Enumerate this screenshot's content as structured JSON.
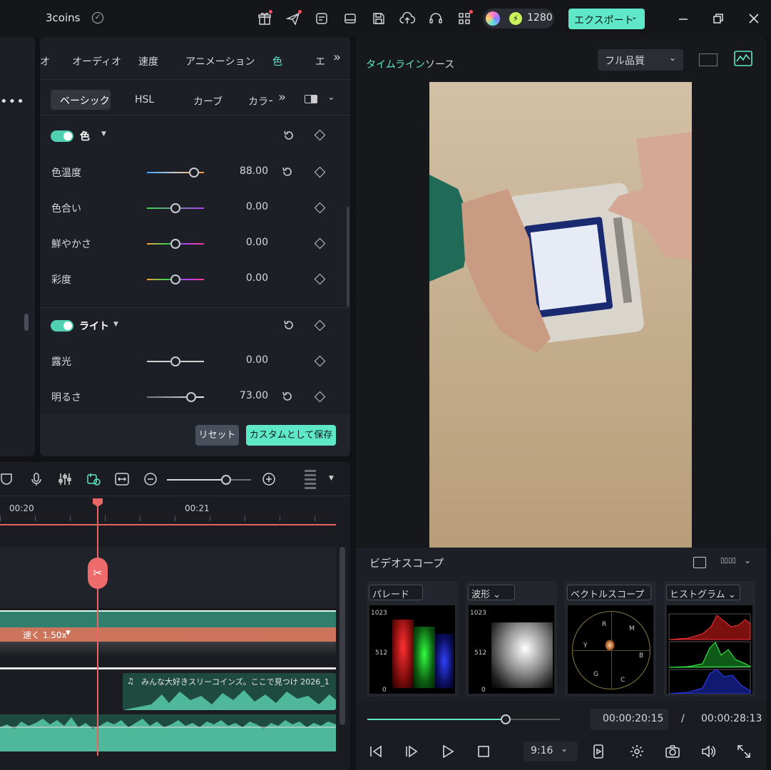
{
  "app": {
    "project_name": "3coins",
    "credits": "1280",
    "export_label": "エクスポート"
  },
  "props": {
    "tabs": [
      "オ",
      "オーディオ",
      "速度",
      "アニメーション",
      "色",
      "エ"
    ],
    "active_tab": "色",
    "subtabs": [
      "ベーシック",
      "HSL",
      "カーブ",
      "カラー"
    ],
    "color_section": {
      "title": "色",
      "rows": [
        {
          "label": "色温度",
          "value": "88.00",
          "level": 0.83
        },
        {
          "label": "色合い",
          "value": "0.00",
          "level": 0.5
        },
        {
          "label": "鮮やかさ",
          "value": "0.00",
          "level": 0.5
        },
        {
          "label": "彩度",
          "value": "0.00",
          "level": 0.5
        }
      ]
    },
    "light_section": {
      "title": "ライト",
      "rows": [
        {
          "label": "露光",
          "value": "0.00",
          "level": 0.5
        },
        {
          "label": "明るさ",
          "value": "73.00",
          "level": 0.78
        }
      ]
    },
    "reset_label": "リセット",
    "save_custom_label": "カスタムとして保存"
  },
  "timeline": {
    "ruler": [
      "00:20",
      "00:21"
    ],
    "speed_label": "速く 1.50x",
    "audio_clip_title": "みんな大好きスリーコインズ。ここで見つけ 2026_1",
    "zoom_level": 0.7
  },
  "player": {
    "tab_timeline": "タイムライン",
    "tab_source": "ソース",
    "quality": "フル品質",
    "videoscope_title": "ビデオスコープ",
    "scope_layout": "▯▯▯▯",
    "scopes": [
      {
        "name": "パレード",
        "ticks": [
          "1023",
          "512",
          "0"
        ]
      },
      {
        "name": "波形",
        "ticks": [
          "1023",
          "512",
          "0"
        ]
      },
      {
        "name": "ベクトルスコープ",
        "ticks": [
          "R",
          "M",
          "B",
          "C",
          "G",
          "Y"
        ]
      },
      {
        "name": "ヒストグラム",
        "ticks": []
      }
    ],
    "current_time": "00:00:20:15",
    "separator": "/",
    "total_time": "00:00:28:13",
    "progress": 0.72,
    "aspect_ratio": "9:16"
  }
}
